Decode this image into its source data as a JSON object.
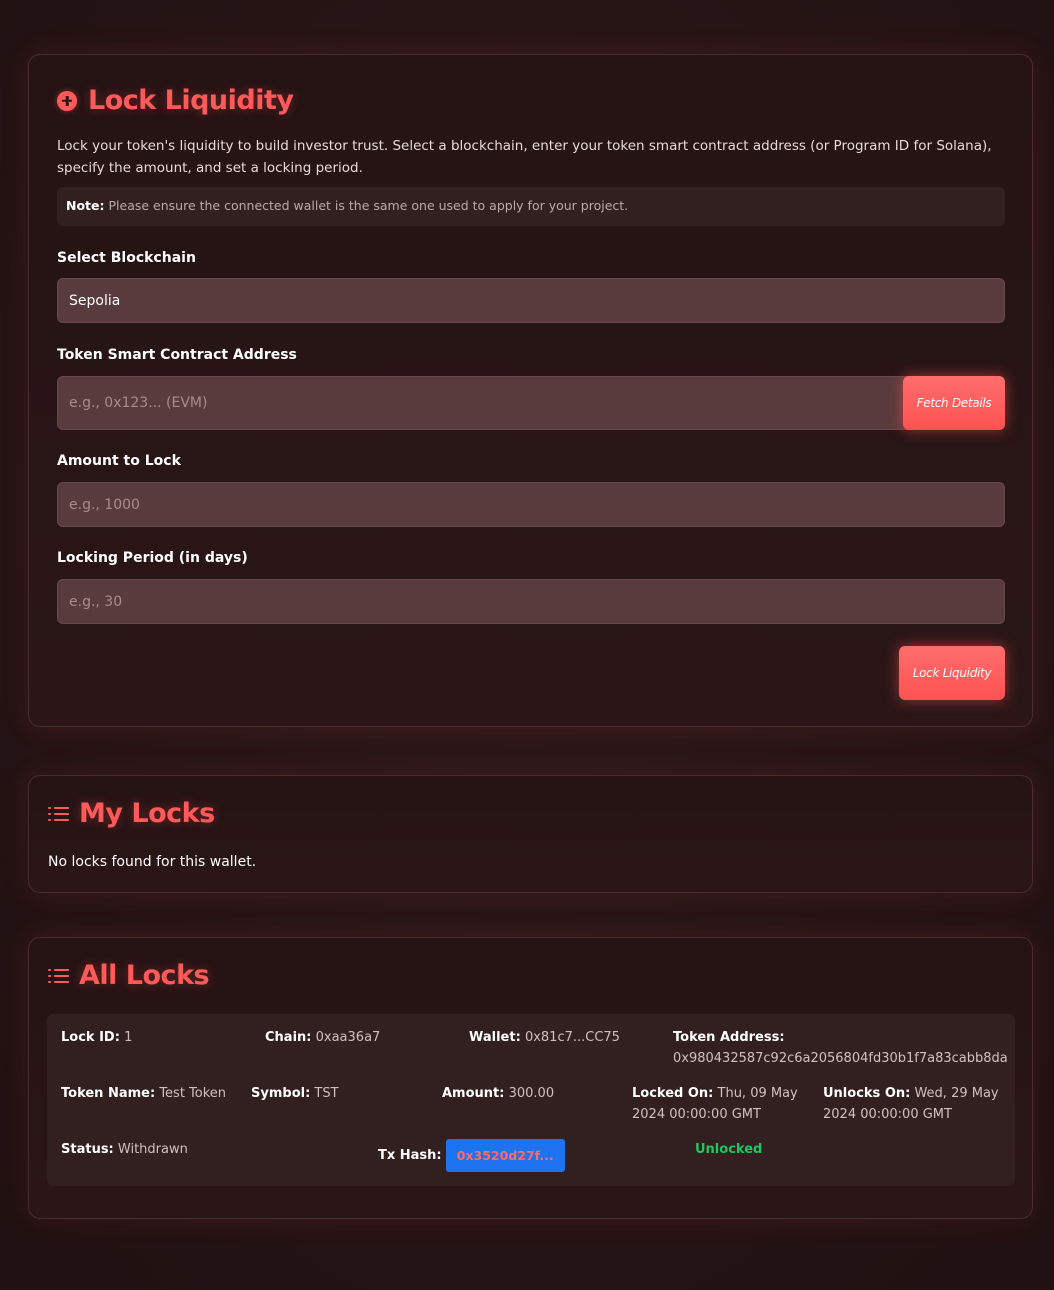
{
  "lock_form": {
    "title": "Lock Liquidity",
    "description": "Lock your token's liquidity to build investor trust. Select a blockchain, enter your token smart contract address (or Program ID for Solana), specify the amount, and set a locking period.",
    "note_label": "Note:",
    "note_text": "Please ensure the connected wallet is the same one used to apply for your project.",
    "blockchain_label": "Select Blockchain",
    "blockchain_value": "Sepolia",
    "address_label": "Token Smart Contract Address",
    "address_placeholder": "e.g., 0x123... (EVM)",
    "fetch_button": "Fetch Details",
    "amount_label": "Amount to Lock",
    "amount_placeholder": "e.g., 1000",
    "period_label": "Locking Period (in days)",
    "period_placeholder": "e.g., 30",
    "submit_button": "Lock Liquidity"
  },
  "my_locks": {
    "title": "My Locks",
    "empty_message": "No locks found for this wallet."
  },
  "all_locks": {
    "title": "All Locks",
    "rows": [
      {
        "lock_id_label": "Lock ID:",
        "lock_id": "1",
        "chain_label": "Chain:",
        "chain": "0xaa36a7",
        "wallet_label": "Wallet:",
        "wallet": "0x81c7...CC75",
        "token_address_label": "Token Address:",
        "token_address": "0x980432587c92c6a2056804fd30b1f7a83cabb8da",
        "token_name_label": "Token Name:",
        "token_name": "Test Token",
        "symbol_label": "Symbol:",
        "symbol": "TST",
        "amount_label": "Amount:",
        "amount": "300.00",
        "locked_on_label": "Locked On:",
        "locked_on": "Thu, 09 May 2024 00:00:00 GMT",
        "unlocks_on_label": "Unlocks On:",
        "unlocks_on": "Wed, 29 May 2024 00:00:00 GMT",
        "status_label": "Status:",
        "status": "Withdrawn",
        "tx_hash_label": "Tx Hash:",
        "tx_hash": "0x3520d27f...",
        "unlock_state": "Unlocked"
      }
    ]
  },
  "colors": {
    "accent": "#ff5a5a",
    "background": "#2a1718",
    "tx_link_bg": "#1e73f0",
    "unlocked_green": "#22c55e"
  }
}
